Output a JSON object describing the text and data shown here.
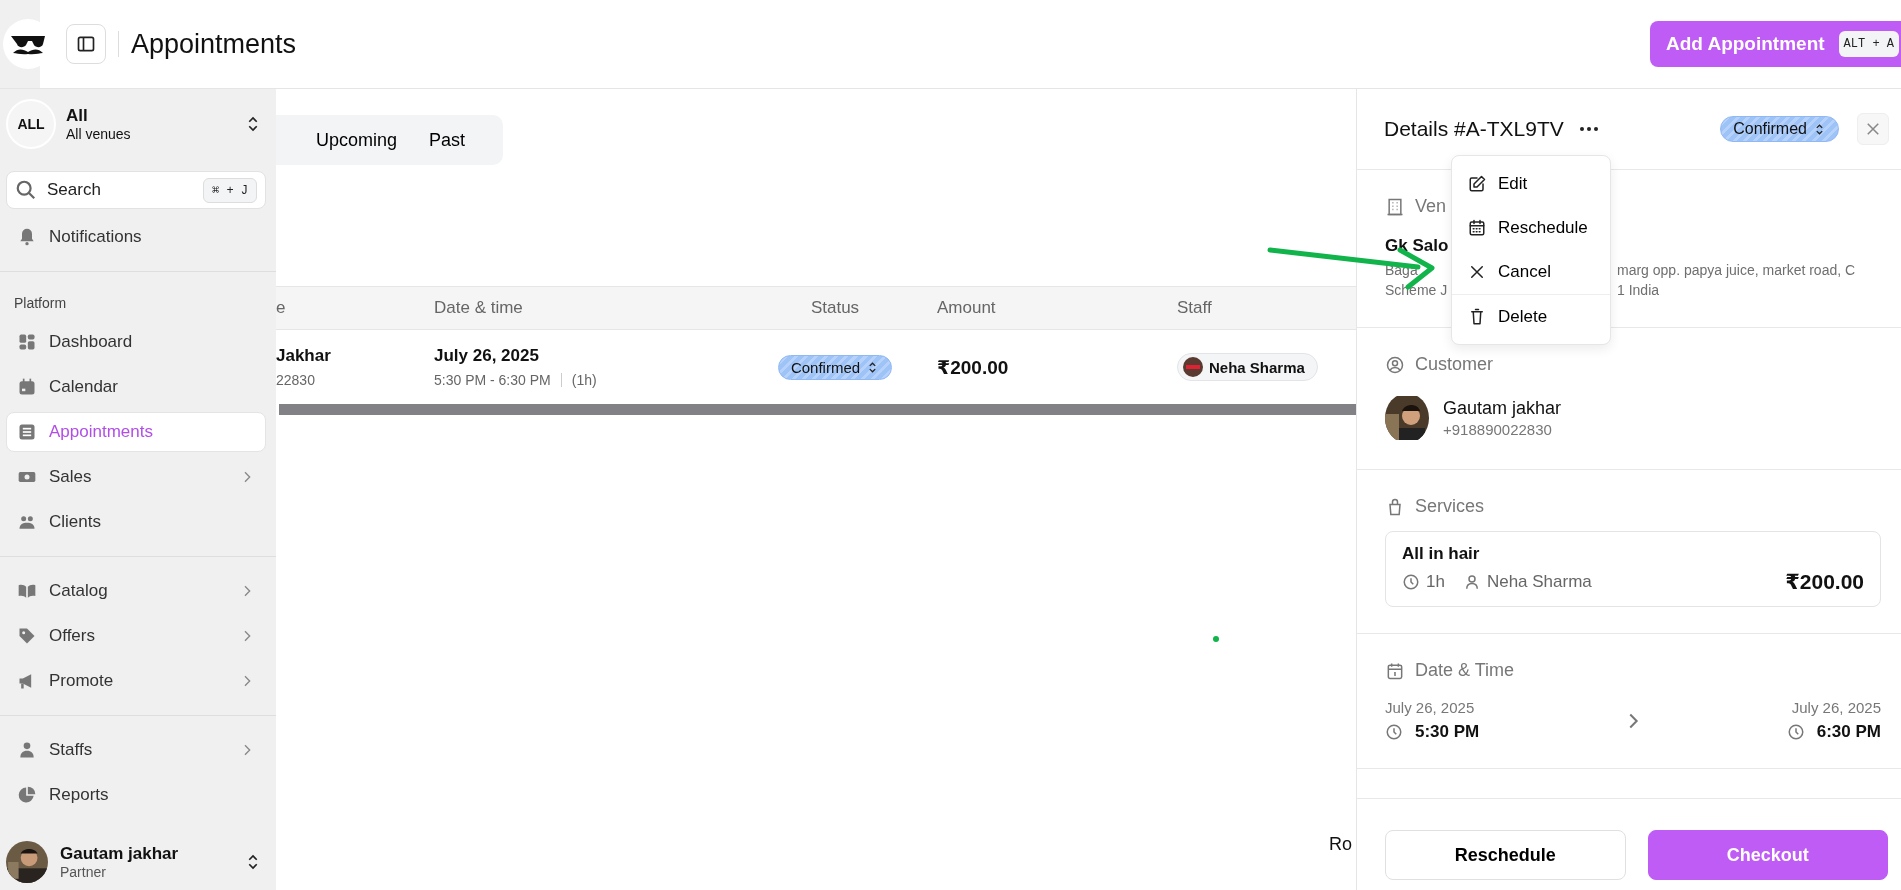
{
  "header": {
    "title": "Appointments",
    "add_button": "Add Appointment",
    "shortcut": "ALT + A"
  },
  "sidebar": {
    "venue": {
      "badge": "ALL",
      "name": "All",
      "sub": "All venues"
    },
    "search": {
      "placeholder": "Search",
      "shortcut": "⌘ + J"
    },
    "notifications": "Notifications",
    "groups": [
      {
        "label": "Platform",
        "items": [
          {
            "label": "Dashboard",
            "selected": false,
            "expandable": false
          },
          {
            "label": "Calendar",
            "selected": false,
            "expandable": false
          },
          {
            "label": "Appointments",
            "selected": true,
            "expandable": false
          },
          {
            "label": "Sales",
            "selected": false,
            "expandable": true
          },
          {
            "label": "Clients",
            "selected": false,
            "expandable": false
          }
        ]
      },
      {
        "items": [
          {
            "label": "Catalog",
            "selected": false,
            "expandable": true
          },
          {
            "label": "Offers",
            "selected": false,
            "expandable": true
          },
          {
            "label": "Promote",
            "selected": false,
            "expandable": true
          }
        ]
      },
      {
        "items": [
          {
            "label": "Staffs",
            "selected": false,
            "expandable": true
          },
          {
            "label": "Reports",
            "selected": false,
            "expandable": false
          }
        ]
      }
    ],
    "user": {
      "name": "Gautam jakhar",
      "role": "Partner"
    }
  },
  "tabs": [
    {
      "label": "Upcoming",
      "selected": false
    },
    {
      "label": "Past",
      "selected": false
    }
  ],
  "table": {
    "columns": [
      "e",
      "Date & time",
      "Status",
      "Amount",
      "Staff"
    ],
    "rows": [
      {
        "name": "Jakhar",
        "phone": "22830",
        "date": "July 26, 2025",
        "time": "5:30 PM - 6:30 PM",
        "duration": "(1h)",
        "status": "Confirmed",
        "amount": "₹200.00",
        "staff": "Neha Sharma"
      }
    ]
  },
  "footer_fragment": "Ro",
  "details": {
    "title": "Details #A-TXL9TV",
    "status": "Confirmed",
    "menu": [
      {
        "label": "Edit",
        "divider_before": false
      },
      {
        "label": "Reschedule",
        "divider_before": false
      },
      {
        "label": "Cancel",
        "divider_before": false
      },
      {
        "label": "Delete",
        "divider_before": true
      }
    ],
    "venue": {
      "heading": "Ven",
      "name": "Gk Salo",
      "lines": [
        {
          "left": "Baga",
          "right": "marg opp. papya juice, market road, C"
        },
        {
          "left": "Scheme J",
          "right": "1 India"
        }
      ]
    },
    "customer": {
      "heading": "Customer",
      "name": "Gautam jakhar",
      "phone": "+918890022830"
    },
    "services": {
      "heading": "Services",
      "items": [
        {
          "name": "All in hair",
          "duration": "1h",
          "staff": "Neha Sharma",
          "price": "₹200.00"
        }
      ]
    },
    "date_time": {
      "heading": "Date & Time",
      "start_date": "July 26, 2025",
      "start_time": "5:30 PM",
      "end_date": "July 26, 2025",
      "end_time": "6:30 PM"
    },
    "buttons": [
      "Reschedule",
      "Checkout"
    ]
  }
}
